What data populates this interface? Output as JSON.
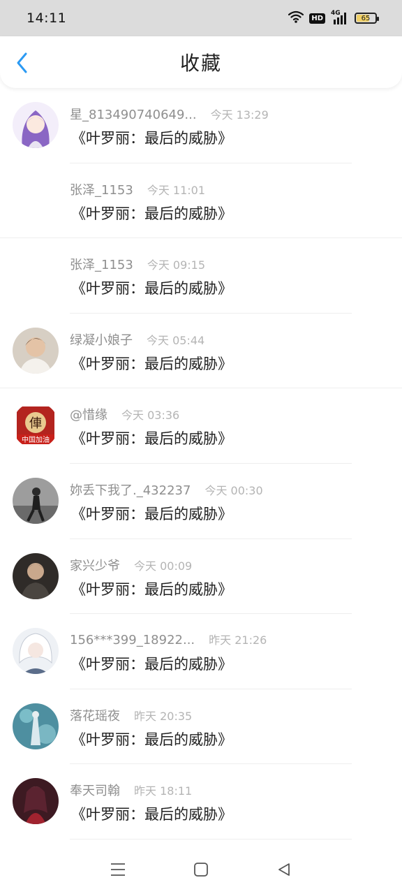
{
  "status_bar": {
    "time": "14:11",
    "hd": "HD",
    "network": "4G",
    "battery_level": "65",
    "battery_fraction": 0.65
  },
  "header": {
    "title": "收藏",
    "accent": "#2b9af3"
  },
  "items": [
    {
      "username": "星_813490740649...",
      "time": "今天 13:29",
      "title": "《叶罗丽：最后的威胁》",
      "avatar": "anime-girl-purple",
      "avatar_color": "#c9b6e6",
      "divider_full": false
    },
    {
      "username": "张泽_1153",
      "time": "今天 11:01",
      "title": "《叶罗丽：最后的威胁》",
      "avatar": "none",
      "avatar_color": "",
      "divider_full": true
    },
    {
      "username": "张泽_1153",
      "time": "今天 09:15",
      "title": "《叶罗丽：最后的威胁》",
      "avatar": "none",
      "avatar_color": "",
      "divider_full": false
    },
    {
      "username": "绿凝小娘子",
      "time": "今天 05:44",
      "title": "《叶罗丽：最后的威胁》",
      "avatar": "boy-photo",
      "avatar_color": "#b9a692",
      "divider_full": true
    },
    {
      "username": "@惜缘",
      "time": "今天 03:36",
      "title": "《叶罗丽：最后的威胁》",
      "avatar": "chinese-badge",
      "avatar_color": "#b3241f",
      "divider_full": false
    },
    {
      "username": "妳丢下我了._432237",
      "time": "今天 00:30",
      "title": "《叶罗丽：最后的威胁》",
      "avatar": "dancer-photo",
      "avatar_color": "#8c8c8c",
      "divider_full": false
    },
    {
      "username": "家兴少爷",
      "time": "今天 00:09",
      "title": "《叶罗丽：最后的威胁》",
      "avatar": "man-dark-photo",
      "avatar_color": "#3b3632",
      "divider_full": false
    },
    {
      "username": "156***399_18922...",
      "time": "昨天 21:26",
      "title": "《叶罗丽：最后的威胁》",
      "avatar": "anime-white-hair",
      "avatar_color": "#d8dde6",
      "divider_full": false
    },
    {
      "username": "落花瑶夜",
      "time": "昨天 20:35",
      "title": "《叶罗丽：最后的威胁》",
      "avatar": "fantasy-teal",
      "avatar_color": "#5fa2b0",
      "divider_full": false
    },
    {
      "username": "奉天司翰",
      "time": "昨天 18:11",
      "title": "《叶罗丽：最后的威胁》",
      "avatar": "anime-red-dress",
      "avatar_color": "#6b2a35",
      "divider_full": false
    }
  ],
  "nav_bar": {
    "menu_icon": "menu-icon",
    "home_icon": "home-icon",
    "back_icon": "back-triangle-icon"
  }
}
